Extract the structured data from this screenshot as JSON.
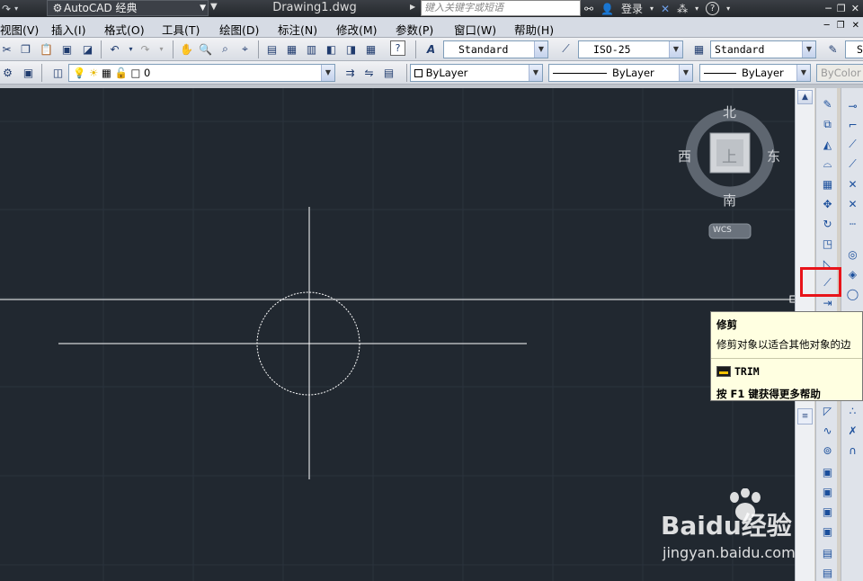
{
  "titlebar": {
    "workspace": "AutoCAD 经典",
    "document_title": "Drawing1.dwg",
    "search_placeholder": "键入关键字或短语",
    "login_label": "登录",
    "help_label": "?"
  },
  "menu": [
    {
      "label": "视图(V)"
    },
    {
      "label": "插入(I)"
    },
    {
      "label": "格式(O)"
    },
    {
      "label": "工具(T)"
    },
    {
      "label": "绘图(D)"
    },
    {
      "label": "标注(N)"
    },
    {
      "label": "修改(M)"
    },
    {
      "label": "参数(P)"
    },
    {
      "label": "窗口(W)"
    },
    {
      "label": "帮助(H)"
    }
  ],
  "styles": {
    "text_style": "Standard",
    "dim_style": "ISO-25",
    "table_style": "Standard",
    "multileader_partial": "S"
  },
  "layers": {
    "current_layer": "0",
    "color": "ByLayer",
    "linetype": "ByLayer",
    "lineweight": "ByLayer",
    "plotstyle": "ByColor"
  },
  "viewcube": {
    "north": "北",
    "south": "南",
    "east": "东",
    "west": "西",
    "face": "上",
    "ucs": "WCS"
  },
  "tooltip": {
    "title": "修剪",
    "description": "修剪对象以适合其他对象的边",
    "command": "TRIM",
    "help": "按 F1 键获得更多帮助"
  },
  "watermark": {
    "main": "Baidu经验",
    "url": "jingyan.baidu.com"
  },
  "colors": {
    "canvas": "#212830",
    "highlight": "#e8141a",
    "tooltip_bg": "#ffffe1"
  }
}
